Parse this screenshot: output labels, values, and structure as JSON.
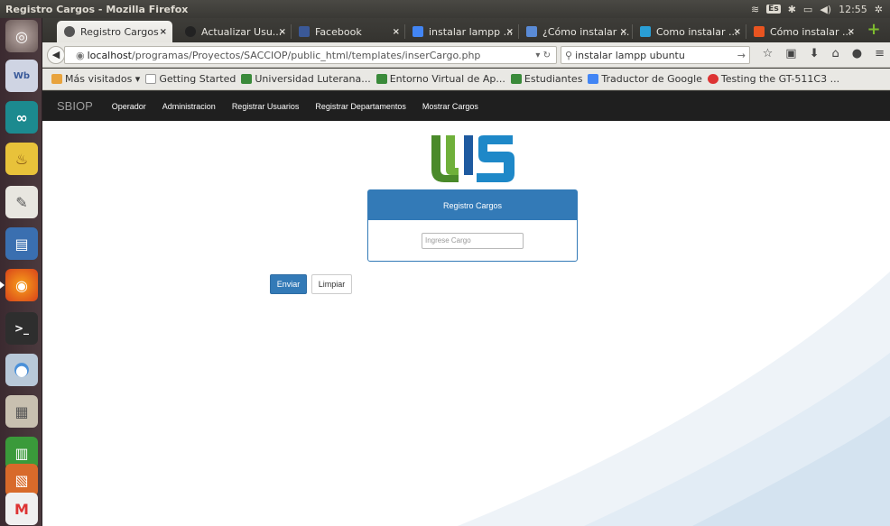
{
  "window": {
    "title": "Registro Cargos - Mozilla Firefox",
    "keyboard": "Es",
    "clock": "12:55"
  },
  "tabs": [
    {
      "label": "Registro Cargos",
      "close": "×",
      "color": "#555555"
    },
    {
      "label": "Actualizar Usu...",
      "close": "×",
      "color": "#222222"
    },
    {
      "label": "Facebook",
      "close": "×",
      "color": "#3b5998"
    },
    {
      "label": "instalar lampp ...",
      "close": "×",
      "color": "#4285f4"
    },
    {
      "label": "¿Cómo instalar ...",
      "close": "×",
      "color": "#5a8bd6"
    },
    {
      "label": "Como instalar ...",
      "close": "×",
      "color": "#2a9fd6"
    },
    {
      "label": "Cómo instalar ...",
      "close": "×",
      "color": "#e95420"
    }
  ],
  "newtab": "+",
  "navbar": {
    "url_host": "localhost",
    "url_path": "/programas/Proyectos/SACCIOP/public_html/templates/inserCargo.php",
    "search_value": "instalar lampp ubuntu"
  },
  "bookmarks": [
    {
      "label": "Más visitados ▾",
      "color": "#e8a33d"
    },
    {
      "label": "Getting Started",
      "color": "#ffffff"
    },
    {
      "label": "Universidad Luterana...",
      "color": "#3a8a3a"
    },
    {
      "label": "Entorno Virtual de Ap...",
      "color": "#3a8a3a"
    },
    {
      "label": "Estudiantes",
      "color": "#3a8a3a"
    },
    {
      "label": "Traductor de Google",
      "color": "#4285f4"
    },
    {
      "label": "Testing the GT-511C3 ...",
      "color": "#d33"
    }
  ],
  "app": {
    "brand": "SBIOP",
    "nav": [
      "Operador",
      "Administracion",
      "Registrar Usuarios",
      "Registrar Departamentos",
      "Mostrar Cargos"
    ],
    "panel_title": "Registro Cargos",
    "input_placeholder": "Ingrese Cargo",
    "submit_label": "Enviar",
    "reset_label": "Limpiar",
    "primary_color": "#337ab7"
  }
}
